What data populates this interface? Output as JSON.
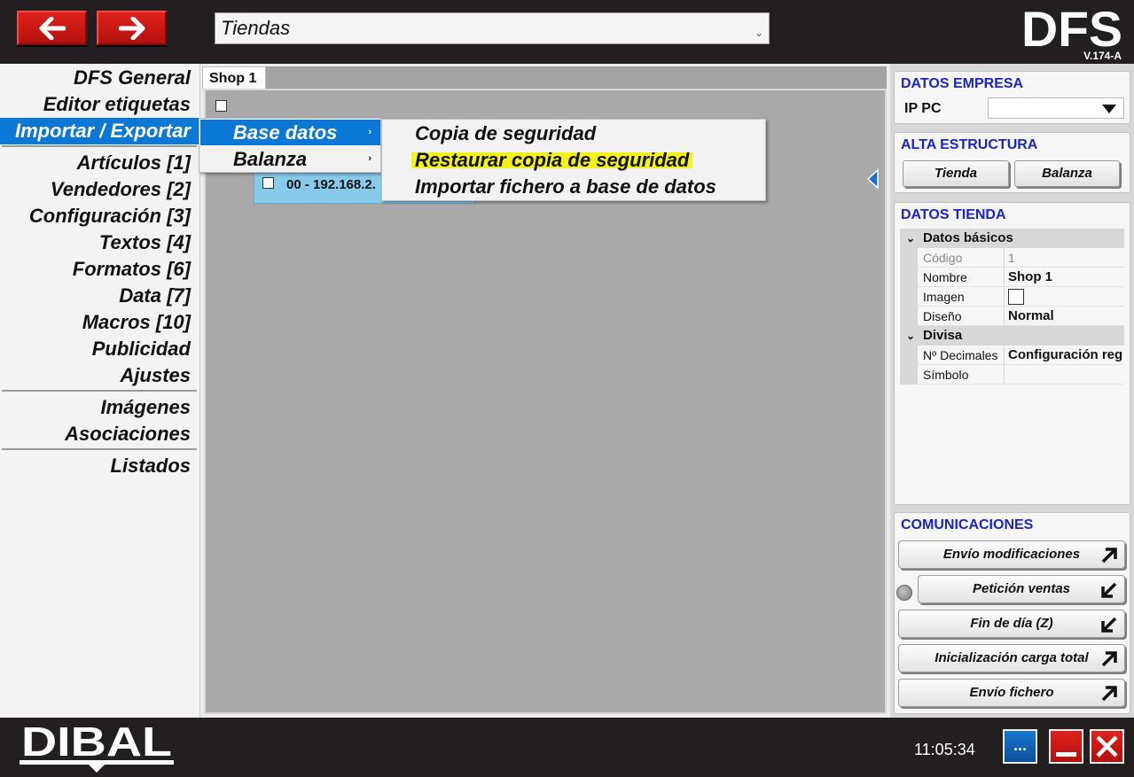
{
  "header": {
    "store_select_value": "Tiendas",
    "logo_text": "DFS",
    "version": "V.174-A"
  },
  "sidebar": {
    "items": [
      {
        "label": "DFS General"
      },
      {
        "label": "Editor etiquetas"
      },
      {
        "label": "Importar / Exportar",
        "active": true
      },
      {
        "label": "Artículos [1]"
      },
      {
        "label": "Vendedores [2]"
      },
      {
        "label": "Configuración [3]"
      },
      {
        "label": "Textos [4]"
      },
      {
        "label": "Formatos [6]"
      },
      {
        "label": "Data [7]"
      },
      {
        "label": "Macros [10]"
      },
      {
        "label": "Publicidad"
      },
      {
        "label": "Ajustes"
      },
      {
        "label": "Imágenes"
      },
      {
        "label": "Asociaciones"
      },
      {
        "label": "Listados"
      }
    ]
  },
  "center": {
    "tab_label": "Shop 1",
    "scale_node_label": "00 - 192.168.2."
  },
  "menu": {
    "level1": [
      {
        "label": "Base datos",
        "highlighted": true
      },
      {
        "label": "Balanza"
      }
    ],
    "level2": [
      {
        "label": "Copia de seguridad"
      },
      {
        "label": "Restaurar copia de seguridad",
        "marked": true
      },
      {
        "label": "Importar fichero a base de datos"
      }
    ],
    "submenu_arrow": "›"
  },
  "right_panel": {
    "datos_empresa": {
      "title": "DATOS EMPRESA",
      "ip_label": "IP PC",
      "ip_value": ""
    },
    "alta_estructura": {
      "title": "ALTA ESTRUCTURA",
      "buttons": [
        "Tienda",
        "Balanza"
      ]
    },
    "datos_tienda": {
      "title": "DATOS TIENDA",
      "categories": [
        {
          "name": "Datos básicos",
          "rows": [
            {
              "name": "Código",
              "value": "1",
              "readonly": true
            },
            {
              "name": "Nombre",
              "value": "Shop 1"
            },
            {
              "name": "Imagen",
              "value": "",
              "checkbox": true
            },
            {
              "name": "Diseño",
              "value": "Normal"
            }
          ]
        },
        {
          "name": "Divisa",
          "rows": [
            {
              "name": "Nº Decimales",
              "value": "Configuración reg"
            },
            {
              "name": "Símbolo",
              "value": ""
            }
          ]
        }
      ]
    },
    "comunicaciones": {
      "title": "COMUNICACIONES",
      "buttons": [
        {
          "label": "Envío modificaciones",
          "icon": "arrow-up-right-icon"
        },
        {
          "label": "Petición ventas",
          "icon": "arrow-down-left-icon"
        },
        {
          "label": "Fin de día (Z)",
          "icon": "arrow-down-left-icon"
        },
        {
          "label": "Inicialización carga total",
          "icon": "arrow-up-right-icon"
        },
        {
          "label": "Envío fichero",
          "icon": "arrow-up-right-icon"
        }
      ]
    }
  },
  "footer": {
    "logo_text": "DIBAL",
    "clock": "11:05:34",
    "more_label": "..."
  },
  "colors": {
    "accent_blue": "#0a78d4",
    "title_blue": "#1a25c7",
    "button_red": "#e0211c",
    "highlight_yellow": "#f3f21a",
    "node_blue": "#87cbeb"
  }
}
